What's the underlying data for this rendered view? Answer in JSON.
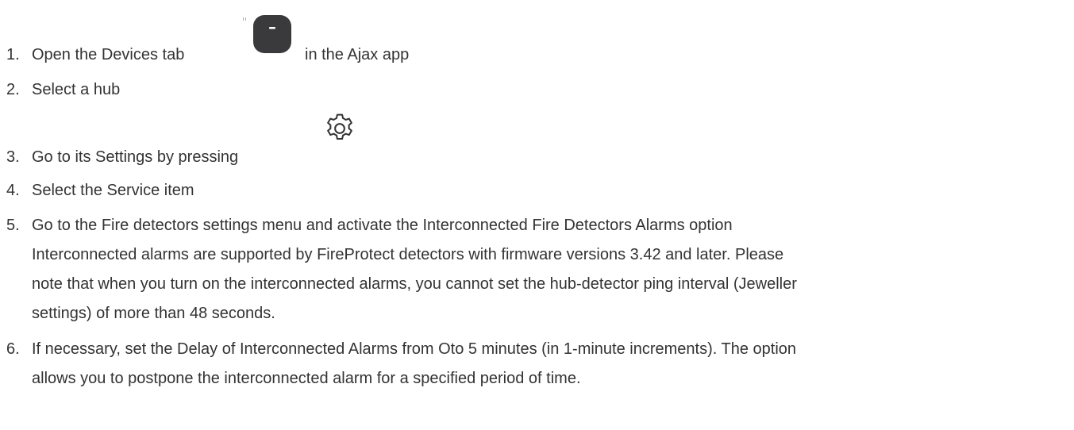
{
  "steps": [
    {
      "number": "1.",
      "text": "Open the Devices tab",
      "text_after": "in the Ajax app",
      "icon": "devices-tab-icon"
    },
    {
      "number": "2.",
      "text": "Select a hub"
    },
    {
      "number": "3.",
      "text": "Go to its Settings by pressing",
      "icon": "gear-icon"
    },
    {
      "number": "4.",
      "text": "Select the Service item"
    },
    {
      "number": "5.",
      "text": "Go to the Fire detectors settings menu and activate the Interconnected Fire Detectors Alarms option",
      "continuation": [
        "Interconnected alarms are supported by FireProtect detectors with firmware versions 3.42 and later. Please",
        "note that when you turn on the interconnected alarms, you cannot set the hub-detector ping interval (Jeweller",
        "settings) of more than 48 seconds."
      ]
    },
    {
      "number": "6.",
      "text": "If necessary, set the Delay of Interconnected Alarms from Oto 5 minutes (in 1-minute increments). The option",
      "continuation": [
        "allows you to postpone the interconnected alarm for a specified period of time."
      ]
    }
  ],
  "colors": {
    "text": "#333333",
    "icon_dark": "#3a3a3c"
  }
}
